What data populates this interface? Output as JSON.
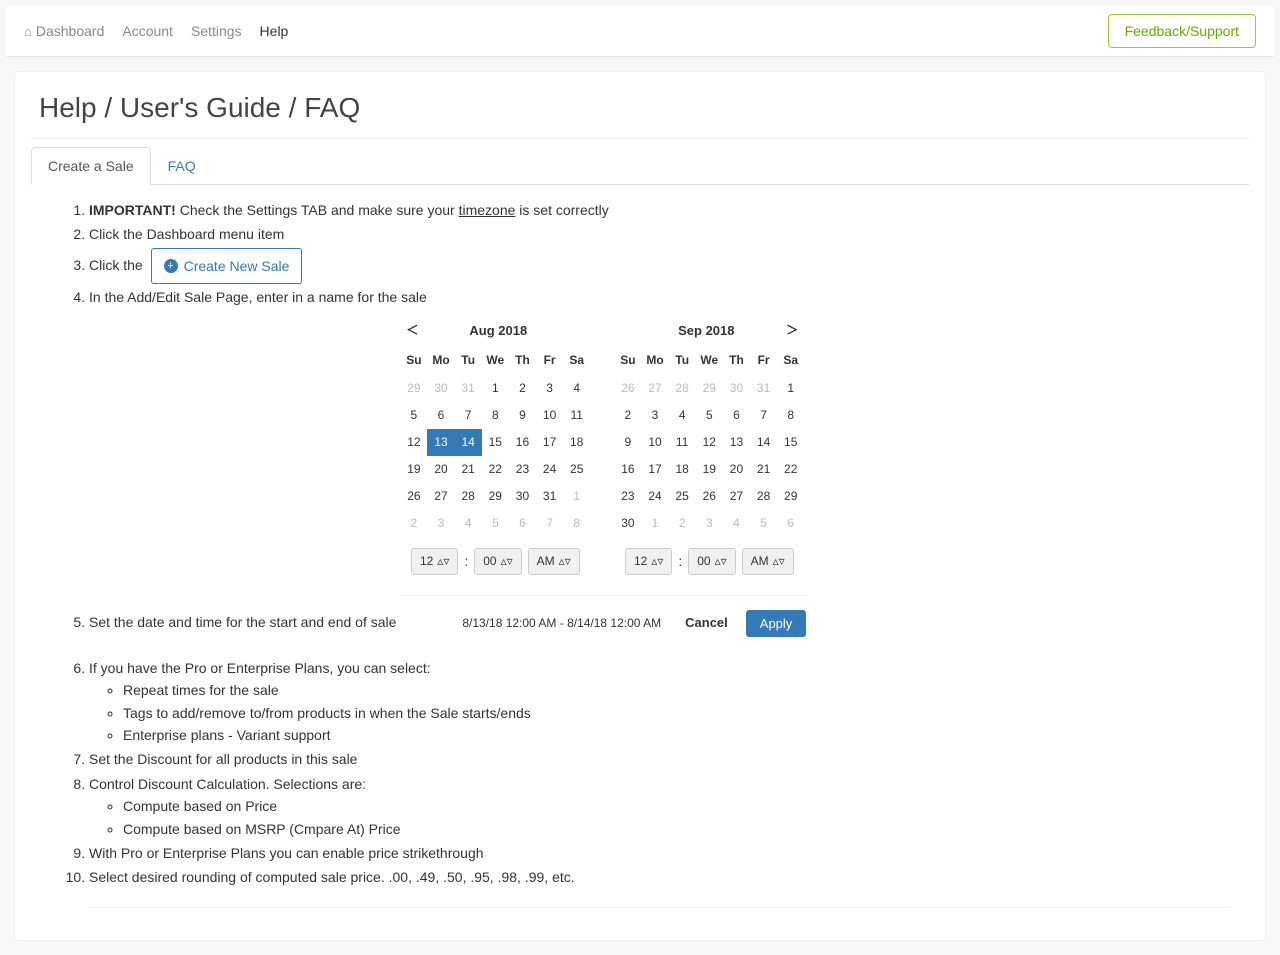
{
  "nav": {
    "items": [
      "Dashboard",
      "Account",
      "Settings",
      "Help"
    ],
    "active": "Help",
    "feedback": "Feedback/Support"
  },
  "page": {
    "title": "Help / User's Guide / FAQ"
  },
  "tabs": {
    "list": [
      "Create a Sale",
      "FAQ"
    ],
    "active": "Create a Sale"
  },
  "steps": {
    "s1_bold": "IMPORTANT!",
    "s1_rest": " Check the Settings TAB and make sure your ",
    "s1_underline": "timezone",
    "s1_tail": " is set correctly",
    "s2": "Click the Dashboard menu item",
    "s3_pre": "Click the ",
    "s3_btn": "Create New Sale",
    "s4": "In the Add/Edit Sale Page, enter in a name for the sale",
    "s5": "Set the date and time for the start and end of sale",
    "s6": "If you have the Pro or Enterprise Plans, you can select:",
    "s6a": "Repeat times for the sale",
    "s6b": "Tags to add/remove to/from products in when the Sale starts/ends",
    "s6c": "Enterprise plans - Variant support",
    "s7": "Set the Discount for all products in this sale",
    "s8": "Control Discount Calculation. Selections are:",
    "s8a": "Compute based on Price",
    "s8b": "Compute based on MSRP (Cmpare At) Price",
    "s9": "With Pro or Enterprise Plans you can enable price strikethrough",
    "s10": "Select desired rounding of computed sale price. .00, .49, .50, .95, .98, .99, etc."
  },
  "cal": {
    "left_title": "Aug 2018",
    "right_title": "Sep 2018",
    "dow": [
      "Su",
      "Mo",
      "Tu",
      "We",
      "Th",
      "Fr",
      "Sa"
    ],
    "left_days": [
      {
        "d": "29",
        "m": true
      },
      {
        "d": "30",
        "m": true
      },
      {
        "d": "31",
        "m": true
      },
      {
        "d": "1"
      },
      {
        "d": "2"
      },
      {
        "d": "3"
      },
      {
        "d": "4"
      },
      {
        "d": "5"
      },
      {
        "d": "6"
      },
      {
        "d": "7"
      },
      {
        "d": "8"
      },
      {
        "d": "9"
      },
      {
        "d": "10"
      },
      {
        "d": "11"
      },
      {
        "d": "12"
      },
      {
        "d": "13",
        "sel": true
      },
      {
        "d": "14",
        "sel": true
      },
      {
        "d": "15"
      },
      {
        "d": "16"
      },
      {
        "d": "17"
      },
      {
        "d": "18"
      },
      {
        "d": "19"
      },
      {
        "d": "20"
      },
      {
        "d": "21"
      },
      {
        "d": "22"
      },
      {
        "d": "23"
      },
      {
        "d": "24"
      },
      {
        "d": "25"
      },
      {
        "d": "26"
      },
      {
        "d": "27"
      },
      {
        "d": "28"
      },
      {
        "d": "29"
      },
      {
        "d": "30"
      },
      {
        "d": "31"
      },
      {
        "d": "1",
        "m": true
      },
      {
        "d": "2",
        "m": true
      },
      {
        "d": "3",
        "m": true
      },
      {
        "d": "4",
        "m": true
      },
      {
        "d": "5",
        "m": true
      },
      {
        "d": "6",
        "m": true
      },
      {
        "d": "7",
        "m": true
      },
      {
        "d": "8",
        "m": true
      }
    ],
    "right_days": [
      {
        "d": "26",
        "m": true
      },
      {
        "d": "27",
        "m": true
      },
      {
        "d": "28",
        "m": true
      },
      {
        "d": "29",
        "m": true
      },
      {
        "d": "30",
        "m": true
      },
      {
        "d": "31",
        "m": true
      },
      {
        "d": "1"
      },
      {
        "d": "2"
      },
      {
        "d": "3"
      },
      {
        "d": "4"
      },
      {
        "d": "5"
      },
      {
        "d": "6"
      },
      {
        "d": "7"
      },
      {
        "d": "8"
      },
      {
        "d": "9"
      },
      {
        "d": "10"
      },
      {
        "d": "11"
      },
      {
        "d": "12"
      },
      {
        "d": "13"
      },
      {
        "d": "14"
      },
      {
        "d": "15"
      },
      {
        "d": "16"
      },
      {
        "d": "17"
      },
      {
        "d": "18"
      },
      {
        "d": "19"
      },
      {
        "d": "20"
      },
      {
        "d": "21"
      },
      {
        "d": "22"
      },
      {
        "d": "23"
      },
      {
        "d": "24"
      },
      {
        "d": "25"
      },
      {
        "d": "26"
      },
      {
        "d": "27"
      },
      {
        "d": "28"
      },
      {
        "d": "29"
      },
      {
        "d": "30"
      },
      {
        "d": "1",
        "m": true
      },
      {
        "d": "2",
        "m": true
      },
      {
        "d": "3",
        "m": true
      },
      {
        "d": "4",
        "m": true
      },
      {
        "d": "5",
        "m": true
      },
      {
        "d": "6",
        "m": true
      }
    ],
    "time_hour": "12",
    "time_min": "00",
    "time_ampm": "AM",
    "range": "8/13/18 12:00 AM - 8/14/18 12:00 AM",
    "cancel": "Cancel",
    "apply": "Apply"
  }
}
